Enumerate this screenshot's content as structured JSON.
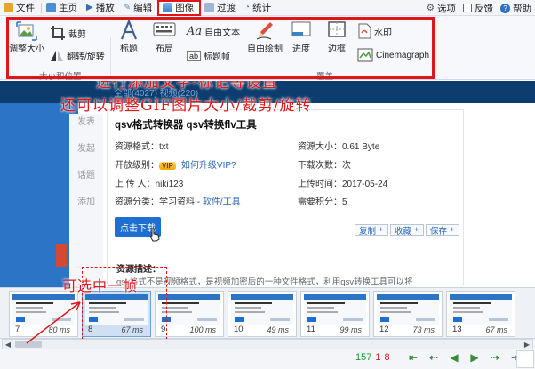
{
  "menubar": {
    "items": [
      {
        "label": "文件",
        "icon": "file-icon",
        "color": "#d88a1a"
      },
      {
        "label": "主页",
        "icon": "home-icon",
        "color": "#4a8fd6"
      },
      {
        "label": "播放",
        "icon": "play-icon",
        "color": "#2f6fbf"
      },
      {
        "label": "编辑",
        "icon": "edit-icon",
        "color": "#4a8fd6"
      },
      {
        "label": "图像",
        "icon": "image-icon",
        "color": "#3a82c9",
        "active": true
      },
      {
        "label": "过渡",
        "icon": "transition-icon",
        "color": "#6a90c2"
      },
      {
        "label": "统计",
        "icon": "stats-icon",
        "color": "#5a7fbf"
      }
    ],
    "right": [
      {
        "label": "选项",
        "icon": "gear-icon"
      },
      {
        "label": "反馈",
        "icon": "checkbox-icon"
      },
      {
        "label": "帮助",
        "icon": "help-icon"
      }
    ]
  },
  "ribbon": {
    "buttons": {
      "resize": "调整大小",
      "crop": "裁剪",
      "flip_rotate": "翻转/旋转",
      "title": "标题",
      "layout": "布局",
      "free_text": "自由文本",
      "title_frame": "标题帧",
      "free_draw": "自由绘制",
      "progress": "进度",
      "border": "边框",
      "watermark": "水印",
      "cinemagraph": "Cinemagraph"
    },
    "group_labels": {
      "size_position": "大小和位置",
      "overlay": "覆盖"
    },
    "accent_color": "#e0151a"
  },
  "annotations": {
    "caption_top": "进行添加文字-标记等设置",
    "caption_second": "还可以调整GIF图片大小/裁剪/旋转",
    "caption_frame": "可选中一帧"
  },
  "webpage": {
    "tabs_faint": "全部(4027)   视频(220)",
    "side_nav": [
      "发表",
      "发起",
      "话题",
      "添加"
    ],
    "title": "qsv格式转换器 qsv转换flv工具",
    "fields": {
      "format_label": "资源格式：",
      "format_value": "txt",
      "size_label": "资源大小：",
      "size_value": "0.61 Byte",
      "level_label": "开放级别：",
      "vip_badge": "VIP",
      "upgrade_link": "如何升级VIP?",
      "downloads_label": "下载次数：",
      "downloads_value": "次",
      "uploader_label": "上 传 人：",
      "uploader_value": "niki123",
      "upload_time_label": "上传时间：",
      "upload_time_value": "2017-05-24",
      "category_label": "资源分类：",
      "category_prefix": "学习资料 - ",
      "category_link": "软件/工具",
      "points_label": "需要积分：",
      "points_value": "5"
    },
    "download_button": "点击下载",
    "actions": [
      "复制",
      "收藏",
      "保存"
    ],
    "desc_title": "资源描述：",
    "desc_text": "qsv格式不是视频格式，是视频加密后的一种文件格式，利用qsv转换工具可以将"
  },
  "filmstrip": {
    "frames": [
      {
        "number": "7",
        "duration": "80 ms",
        "selected": false
      },
      {
        "number": "8",
        "duration": "67 ms",
        "selected": true
      },
      {
        "number": "9",
        "duration": "100 ms",
        "selected": false
      },
      {
        "number": "10",
        "duration": "49 ms",
        "selected": false
      },
      {
        "number": "11",
        "duration": "99 ms",
        "selected": false
      },
      {
        "number": "12",
        "duration": "73 ms",
        "selected": false
      },
      {
        "number": "13",
        "duration": "67 ms",
        "selected": false
      }
    ]
  },
  "status": {
    "total_frames": "157",
    "selected_count": "1",
    "current_frame": "8"
  }
}
